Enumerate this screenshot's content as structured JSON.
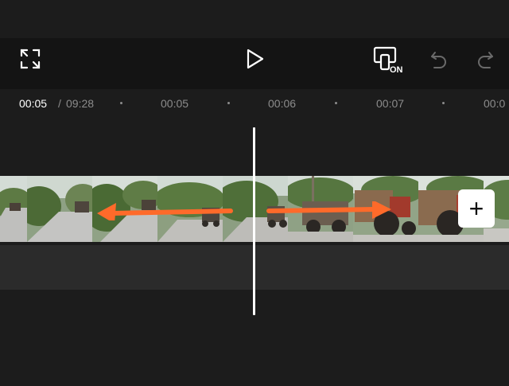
{
  "app": {
    "accent_color": "#ff6a2a",
    "background_color": "#1c1c1c"
  },
  "toolbar": {
    "fullscreen_icon": "expand-icon",
    "play_icon": "play-icon",
    "auto_reframe_icon": "screen-on-icon",
    "auto_reframe_badge": "ON",
    "undo_icon": "undo-icon",
    "redo_icon": "redo-icon"
  },
  "timeline": {
    "current_time": "00:05",
    "separator": "/",
    "total_time": "09:28",
    "ticks": [
      "00:05",
      "00:06",
      "00:07",
      "00:0"
    ]
  },
  "clip": {
    "frames": [
      "road-left-frame",
      "tractor-distant-frame",
      "road-trees-frame",
      "tractor-road-frame",
      "tractor-distant-frame",
      "tractor-road-frame",
      "tractor-near-frame",
      "tractor-red-frame"
    ],
    "add_button_label": "+"
  },
  "annotations": {
    "arrow_left": "left-arrow",
    "arrow_right": "right-arrow"
  }
}
